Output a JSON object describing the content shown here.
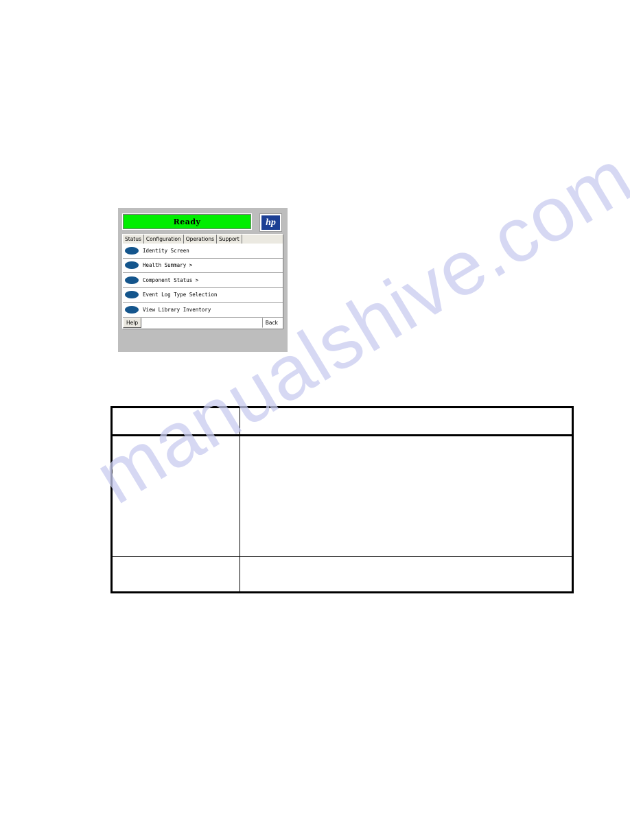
{
  "page": {
    "background_color": "#ffffff",
    "watermark": {
      "text": "manualshive.com",
      "color": "#c9ccf0"
    }
  },
  "device_screenshot": {
    "panel_background": "#bdbdbd",
    "status_bar": {
      "label": "Ready",
      "background_color": "#00ee00",
      "text_color": "#000000"
    },
    "brand_logo": {
      "text": "hp",
      "background_color": "#1c3f94",
      "text_color": "#ffffff",
      "icon_name": "hp-logo-icon"
    },
    "tabs": [
      {
        "label": "Status",
        "active": true
      },
      {
        "label": "Configuration",
        "active": false
      },
      {
        "label": "Operations",
        "active": false
      },
      {
        "label": "Support",
        "active": false
      }
    ],
    "menu_items": [
      {
        "label": "Identity Screen",
        "bullet_color": "#14558c"
      },
      {
        "label": "Health Summary >",
        "bullet_color": "#14558c"
      },
      {
        "label": "Component Status >",
        "bullet_color": "#14558c"
      },
      {
        "label": "Event Log Type Selection",
        "bullet_color": "#14558c"
      },
      {
        "label": "View Library Inventory",
        "bullet_color": "#14558c"
      }
    ],
    "bottom_bar": {
      "help_label": "Help",
      "back_label": "Back"
    }
  },
  "info_table": {
    "columns": [
      "",
      ""
    ],
    "rows": [
      {
        "cells": [
          "",
          ""
        ]
      },
      {
        "cells": [
          "",
          ""
        ]
      },
      {
        "cells": [
          "",
          ""
        ]
      }
    ]
  }
}
